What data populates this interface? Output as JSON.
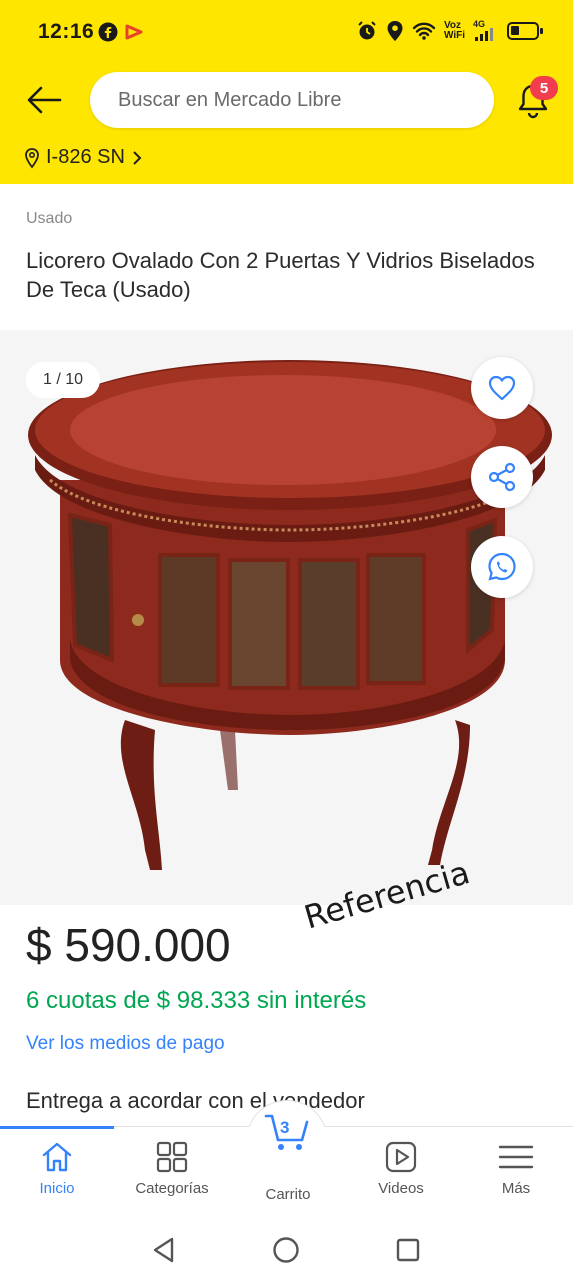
{
  "status_bar": {
    "time": "12:16",
    "network_label_top": "Voz",
    "network_label_bottom": "WiFi",
    "network_type": "4G"
  },
  "header": {
    "search_placeholder": "Buscar en Mercado Libre",
    "notification_count": "5",
    "location": "I-826 SN"
  },
  "product": {
    "condition": "Usado",
    "title": "Licorero Ovalado Con 2 Puertas Y Vidrios Biselados De Teca (Usado)",
    "image_counter": "1 / 10",
    "price": "$ 590.000",
    "overlay_text": "Referencia",
    "installments": "6 cuotas de $ 98.333 sin interés",
    "payment_link": "Ver los medios de pago",
    "delivery": "Entrega a acordar con el vendedor"
  },
  "tabbar": {
    "tabs": [
      {
        "label": "Inicio",
        "icon": "home-icon",
        "active": true
      },
      {
        "label": "Categorías",
        "icon": "grid-icon",
        "active": false
      },
      {
        "label": "Carrito",
        "icon": "cart-icon",
        "active": false
      },
      {
        "label": "Videos",
        "icon": "play-icon",
        "active": false
      },
      {
        "label": "Más",
        "icon": "menu-icon",
        "active": false
      }
    ],
    "cart_count": "3"
  },
  "colors": {
    "brand_yellow": "#FFE600",
    "accent_blue": "#3483FA",
    "success_green": "#00A650",
    "badge_red": "#F23D4F"
  }
}
